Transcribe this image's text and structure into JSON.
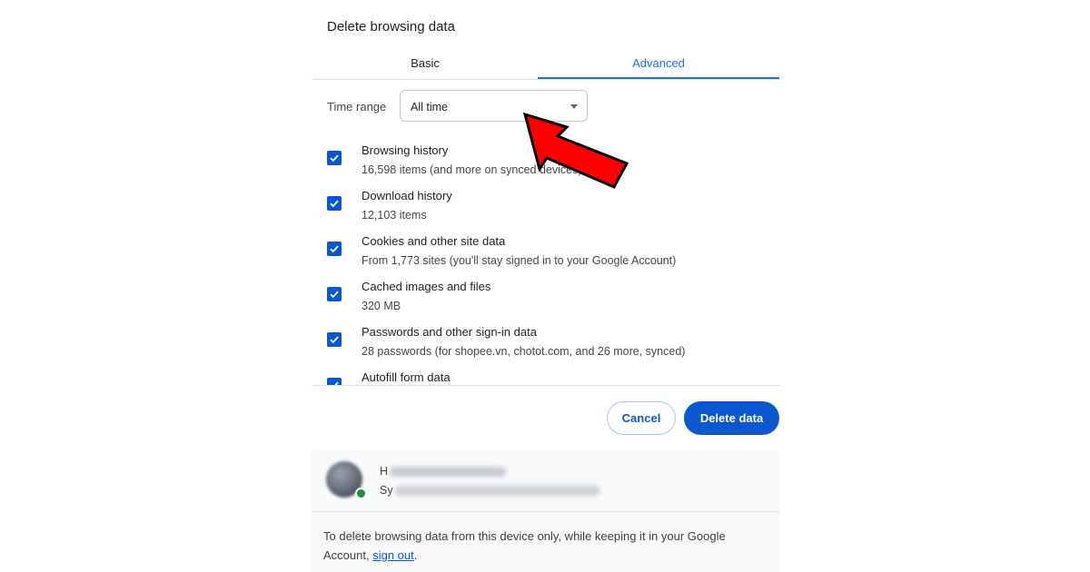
{
  "dialog": {
    "title": "Delete browsing data",
    "tabs": [
      {
        "label": "Basic",
        "active": false
      },
      {
        "label": "Advanced",
        "active": true
      }
    ],
    "time_range": {
      "label": "Time range",
      "value": "All time"
    },
    "items": [
      {
        "title": "Browsing history",
        "subtitle": "16,598 items (and more on synced devices)",
        "checked": true
      },
      {
        "title": "Download history",
        "subtitle": "12,103 items",
        "checked": true
      },
      {
        "title": "Cookies and other site data",
        "subtitle": "From 1,773 sites (you'll stay signed in to your Google Account)",
        "checked": true
      },
      {
        "title": "Cached images and files",
        "subtitle": "320 MB",
        "checked": true
      },
      {
        "title": "Passwords and other sign-in data",
        "subtitle": "28 passwords (for shopee.vn, chotot.com, and 26 more, synced)",
        "checked": true
      },
      {
        "title": "Autofill form data",
        "subtitle": "",
        "checked": true
      }
    ],
    "buttons": {
      "cancel": "Cancel",
      "delete": "Delete data"
    }
  },
  "account": {
    "name_prefix": "H",
    "email_prefix": "Sy",
    "note_text": "To delete browsing data from this device only, while keeping it in your Google Account, ",
    "note_link": "sign out",
    "note_end": "."
  },
  "colors": {
    "accent": "#0b57d0",
    "tab_accent": "#1a73e8",
    "arrow": "#ff0000"
  }
}
